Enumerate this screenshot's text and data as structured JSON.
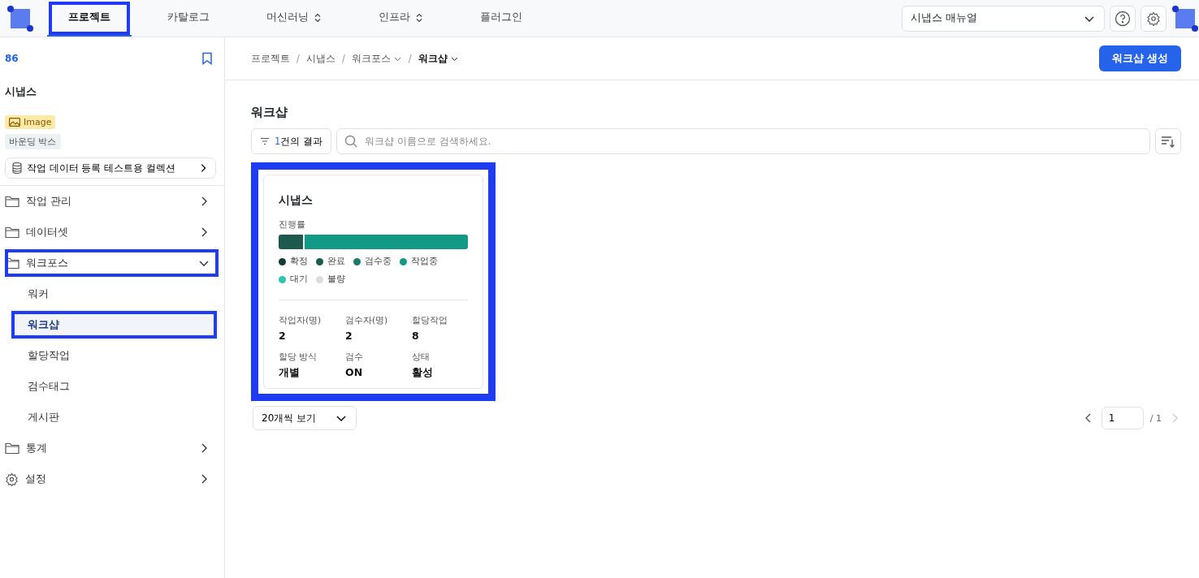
{
  "top_nav": {
    "tabs": [
      {
        "label": "프로젝트",
        "selected": true,
        "highlighted": true,
        "has_caret": false
      },
      {
        "label": "카탈로그",
        "selected": false,
        "highlighted": false,
        "has_caret": false
      },
      {
        "label": "머신러닝",
        "selected": false,
        "highlighted": false,
        "has_caret": true
      },
      {
        "label": "인프라",
        "selected": false,
        "highlighted": false,
        "has_caret": true
      },
      {
        "label": "플러그인",
        "selected": false,
        "highlighted": false,
        "has_caret": false
      }
    ],
    "manual_select": {
      "value": "시냅스 매뉴얼"
    }
  },
  "sidebar": {
    "project_id": "86",
    "project_name": "시냅스",
    "tags": [
      {
        "kind": "image",
        "label": "Image"
      },
      {
        "kind": "plain",
        "label": "바운딩 박스"
      }
    ],
    "collection": "작업 데이터 등록 테스트용 컬렉션",
    "items": [
      {
        "kind": "folder",
        "label": "작업 관리",
        "expanded": false,
        "highlighted": false
      },
      {
        "kind": "folder",
        "label": "데이터셋",
        "expanded": false,
        "highlighted": false
      },
      {
        "kind": "folder",
        "label": "워크포스",
        "expanded": true,
        "highlighted": true,
        "children": [
          {
            "label": "워커",
            "selected": false,
            "highlighted": false
          },
          {
            "label": "워크샵",
            "selected": true,
            "highlighted": true
          },
          {
            "label": "할당작업",
            "selected": false,
            "highlighted": false
          },
          {
            "label": "검수태그",
            "selected": false,
            "highlighted": false
          },
          {
            "label": "게시판",
            "selected": false,
            "highlighted": false
          }
        ]
      },
      {
        "kind": "folder",
        "label": "통계",
        "expanded": false,
        "highlighted": false
      },
      {
        "kind": "settings",
        "label": "설정",
        "expanded": false,
        "highlighted": false
      }
    ]
  },
  "breadcrumb": [
    {
      "label": "프로젝트",
      "has_caret": false,
      "current": false
    },
    {
      "separator": "/",
      "label": "시냅스",
      "has_caret": false,
      "current": false
    },
    {
      "separator": "/",
      "label": "워크포스",
      "has_caret": true,
      "current": false
    },
    {
      "separator": "/",
      "label": "워크샵",
      "has_caret": true,
      "current": true
    }
  ],
  "create_button": "워크샵 생성",
  "page_title": "워크샵",
  "filter": {
    "count": "1",
    "label": "건의 결과"
  },
  "search": {
    "placeholder": "워크샵 이름으로 검색하세요."
  },
  "cards": [
    {
      "title": "시냅스",
      "highlighted": true,
      "progress_label": "진행률",
      "segments": [
        {
          "color": "#1c5a50",
          "level": 0.13
        },
        {
          "color": "#139a87",
          "level": 0.87
        }
      ],
      "legend": [
        {
          "label": "확정",
          "color": "#123c36"
        },
        {
          "label": "완료",
          "color": "#1c5a50"
        },
        {
          "label": "검수중",
          "color": "#1d7a6b"
        },
        {
          "label": "작업중",
          "color": "#139a87"
        },
        {
          "label": "대기",
          "color": "#2cc7ad"
        },
        {
          "label": "불량",
          "color": "#d9dce1"
        }
      ],
      "stats": [
        {
          "label": "작업자(명)",
          "value": "2"
        },
        {
          "label": "검수자(명)",
          "value": "2"
        },
        {
          "label": "할당작업",
          "value": "8"
        },
        {
          "label": "할당 방식",
          "value": "개별"
        },
        {
          "label": "검수",
          "value": "ON"
        },
        {
          "label": "상태",
          "value": "활성"
        }
      ]
    }
  ],
  "page_size": "20개씩 보기",
  "pagination": {
    "page": "1",
    "total": "/ 1"
  }
}
